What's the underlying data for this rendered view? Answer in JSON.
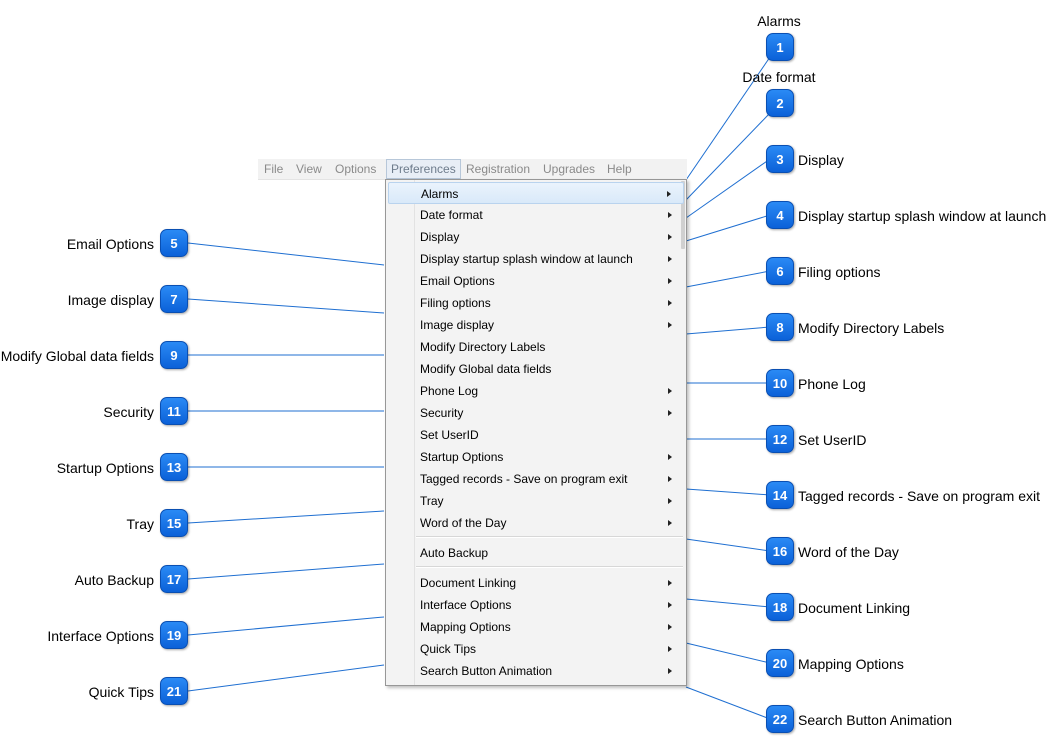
{
  "menubar": {
    "items": [
      "File",
      "View",
      "Options",
      "Preferences",
      "Registration",
      "Upgrades",
      "Help"
    ],
    "active": "Preferences"
  },
  "menu": {
    "items": [
      {
        "label": "Alarms",
        "submenu": true
      },
      {
        "label": "Date format",
        "submenu": true
      },
      {
        "label": "Display",
        "submenu": true
      },
      {
        "label": "Display startup splash window at launch",
        "submenu": true
      },
      {
        "label": "Email Options",
        "submenu": true
      },
      {
        "label": "Filing options",
        "submenu": true
      },
      {
        "label": "Image display",
        "submenu": true
      },
      {
        "label": "Modify Directory Labels",
        "submenu": false
      },
      {
        "label": "Modify Global data fields",
        "submenu": false
      },
      {
        "label": "Phone Log",
        "submenu": true
      },
      {
        "label": "Security",
        "submenu": true
      },
      {
        "label": "Set UserID",
        "submenu": false
      },
      {
        "label": "Startup Options",
        "submenu": true
      },
      {
        "label": "Tagged records - Save on program exit",
        "submenu": true
      },
      {
        "label": "Tray",
        "submenu": true
      },
      {
        "label": "Word of the Day",
        "submenu": true
      },
      {
        "label": "Auto Backup",
        "submenu": false
      },
      {
        "label": "Document Linking",
        "submenu": true
      },
      {
        "label": "Interface Options",
        "submenu": true
      },
      {
        "label": "Mapping Options",
        "submenu": true
      },
      {
        "label": "Quick Tips",
        "submenu": true
      },
      {
        "label": "Search Button Animation",
        "submenu": true
      }
    ]
  },
  "callouts": [
    {
      "number": "1",
      "label": "Alarms"
    },
    {
      "number": "2",
      "label": "Date format"
    },
    {
      "number": "3",
      "label": "Display"
    },
    {
      "number": "4",
      "label": "Display startup splash window at launch"
    },
    {
      "number": "5",
      "label": "Email Options"
    },
    {
      "number": "6",
      "label": "Filing options"
    },
    {
      "number": "7",
      "label": "Image display"
    },
    {
      "number": "8",
      "label": "Modify Directory Labels"
    },
    {
      "number": "9",
      "label": "Modify Global data fields"
    },
    {
      "number": "10",
      "label": "Phone Log"
    },
    {
      "number": "11",
      "label": "Security"
    },
    {
      "number": "12",
      "label": "Set UserID"
    },
    {
      "number": "13",
      "label": "Startup Options"
    },
    {
      "number": "14",
      "label": "Tagged records - Save on program exit"
    },
    {
      "number": "15",
      "label": "Tray"
    },
    {
      "number": "16",
      "label": "Word of the Day"
    },
    {
      "number": "17",
      "label": "Auto Backup"
    },
    {
      "number": "18",
      "label": "Document Linking"
    },
    {
      "number": "19",
      "label": "Interface Options"
    },
    {
      "number": "20",
      "label": "Mapping Options"
    },
    {
      "number": "21",
      "label": "Quick Tips"
    },
    {
      "number": "22",
      "label": "Search Button Animation"
    }
  ],
  "colors": {
    "badge": "#1473e6",
    "leader": "#1f6fd1",
    "highlight": "#d9e9f9"
  }
}
